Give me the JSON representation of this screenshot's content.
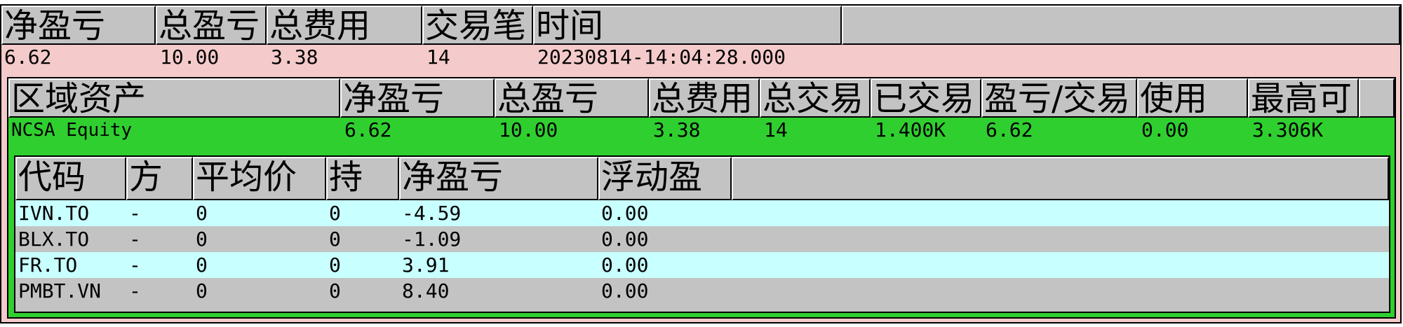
{
  "summary": {
    "headers": [
      "净盈亏",
      "总盈亏",
      "总费用",
      "交易笔",
      "时间",
      ""
    ],
    "values": [
      "6.62",
      "10.00",
      "3.38",
      "14",
      "20230814-14:04:28.000"
    ]
  },
  "region": {
    "headers": [
      "区域资产",
      "净盈亏",
      "总盈亏",
      "总费用",
      "总交易",
      "已交易",
      "盈亏/交易",
      "使用",
      "最高可",
      ""
    ],
    "values": [
      "NCSA Equity",
      "6.62",
      "10.00",
      "3.38",
      "14",
      "1.400K",
      "6.62",
      "0.00",
      "3.306K"
    ]
  },
  "positions": {
    "headers": [
      "代码",
      "方",
      "平均价",
      "持",
      "净盈亏",
      "浮动盈",
      ""
    ],
    "rows": [
      [
        "IVN.TO",
        "-",
        "0",
        "0",
        "-4.59",
        "0.00"
      ],
      [
        "BLX.TO",
        "-",
        "0",
        "0",
        "-1.09",
        "0.00"
      ],
      [
        "FR.TO",
        "-",
        "0",
        "0",
        "3.91",
        "0.00"
      ],
      [
        "PMBT.VN",
        "-",
        "0",
        "0",
        "8.40",
        "0.00"
      ]
    ]
  },
  "colors": {
    "summary_bg": "#f4caca",
    "region_bg": "#2fcf2f",
    "row_alt_a": "#c8ffff",
    "row_alt_b": "#c3c3c3",
    "header_bg": "#c3c3c3"
  }
}
